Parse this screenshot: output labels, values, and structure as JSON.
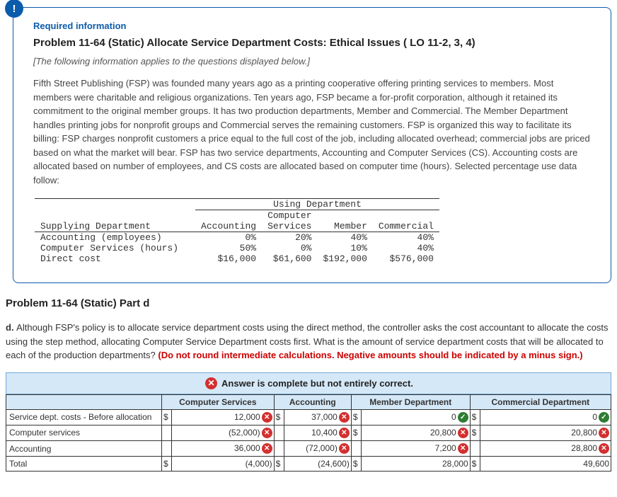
{
  "card": {
    "badge": "!",
    "required_label": "Required information",
    "title": "Problem 11-64 (Static) Allocate Service Department Costs: Ethical Issues ( LO 11-2, 3, 4)",
    "italic_note": "[The following information applies to the questions displayed below.]",
    "body": "Fifth Street Publishing (FSP) was founded many years ago as a printing cooperative offering printing services to members. Most members were charitable and religious organizations. Ten years ago, FSP became a for-profit corporation, although it retained its commitment to the original member groups. It has two production departments, Member and Commercial. The Member Department handles printing jobs for nonprofit groups and Commercial serves the remaining customers. FSP is organized this way to facilitate its billing: FSP charges nonprofit customers a price equal to the full cost of the job, including allocated overhead; commercial jobs are priced based on what the market will bear. FSP has two service departments, Accounting and Computer Services (CS). Accounting costs are allocated based on number of employees, and CS costs are allocated based on computer time (hours). Selected percentage use data follow:"
  },
  "usage": {
    "group_header": "Using Department",
    "col_supply": "Supplying Department",
    "col_acct": "Accounting",
    "col_cs": "Computer\nServices",
    "col_member": "Member",
    "col_comm": "Commercial",
    "rows": [
      {
        "label": "Accounting (employees)",
        "acct": "0%",
        "cs": "20%",
        "member": "40%",
        "comm": "40%"
      },
      {
        "label": "Computer Services (hours)",
        "acct": "50%",
        "cs": "0%",
        "member": "10%",
        "comm": "40%"
      },
      {
        "label": "Direct cost",
        "acct": "$16,000",
        "cs": "$61,600",
        "member": "$192,000",
        "comm": "$576,000"
      }
    ]
  },
  "part": {
    "title": "Problem 11-64 (Static) Part d",
    "lead": "d. ",
    "body": "Although FSP's policy is to allocate service department costs using the direct method, the controller asks the cost accountant to allocate the costs using the step method, allocating Computer Service Department costs first. What is the amount of service department costs that will be allocated to each of the production departments? ",
    "red_note": "(Do not round intermediate calculations. Negative amounts should be indicated by a minus sign.)"
  },
  "feedback": "Answer is complete but not entirely correct.",
  "answer": {
    "headers": [
      "",
      "Computer Services",
      "Accounting",
      "Member Department",
      "Commercial Department"
    ],
    "rows": [
      {
        "label": "Service dept. costs - Before allocation",
        "cells": [
          {
            "cur": "$",
            "val": "12,000",
            "mark": "x"
          },
          {
            "cur": "$",
            "val": "37,000",
            "mark": "x"
          },
          {
            "cur": "$",
            "val": "0",
            "mark": "ok"
          },
          {
            "cur": "$",
            "val": "0",
            "mark": "ok"
          }
        ]
      },
      {
        "label": "Computer services",
        "cells": [
          {
            "cur": "",
            "val": "(52,000)",
            "mark": "x"
          },
          {
            "cur": "",
            "val": "10,400",
            "mark": "x"
          },
          {
            "cur": "$",
            "val": "20,800",
            "mark": "x"
          },
          {
            "cur": "$",
            "val": "20,800",
            "mark": "x"
          }
        ]
      },
      {
        "label": "Accounting",
        "cells": [
          {
            "cur": "",
            "val": "36,000",
            "mark": "x"
          },
          {
            "cur": "",
            "val": "(72,000)",
            "mark": "x"
          },
          {
            "cur": "",
            "val": "7,200",
            "mark": "x"
          },
          {
            "cur": "",
            "val": "28,800",
            "mark": "x"
          }
        ]
      },
      {
        "label": "Total",
        "cells": [
          {
            "cur": "$",
            "val": "(4,000)",
            "mark": ""
          },
          {
            "cur": "$",
            "val": "(24,600)",
            "mark": ""
          },
          {
            "cur": "$",
            "val": "28,000",
            "mark": ""
          },
          {
            "cur": "$",
            "val": "49,600",
            "mark": ""
          }
        ]
      }
    ]
  }
}
